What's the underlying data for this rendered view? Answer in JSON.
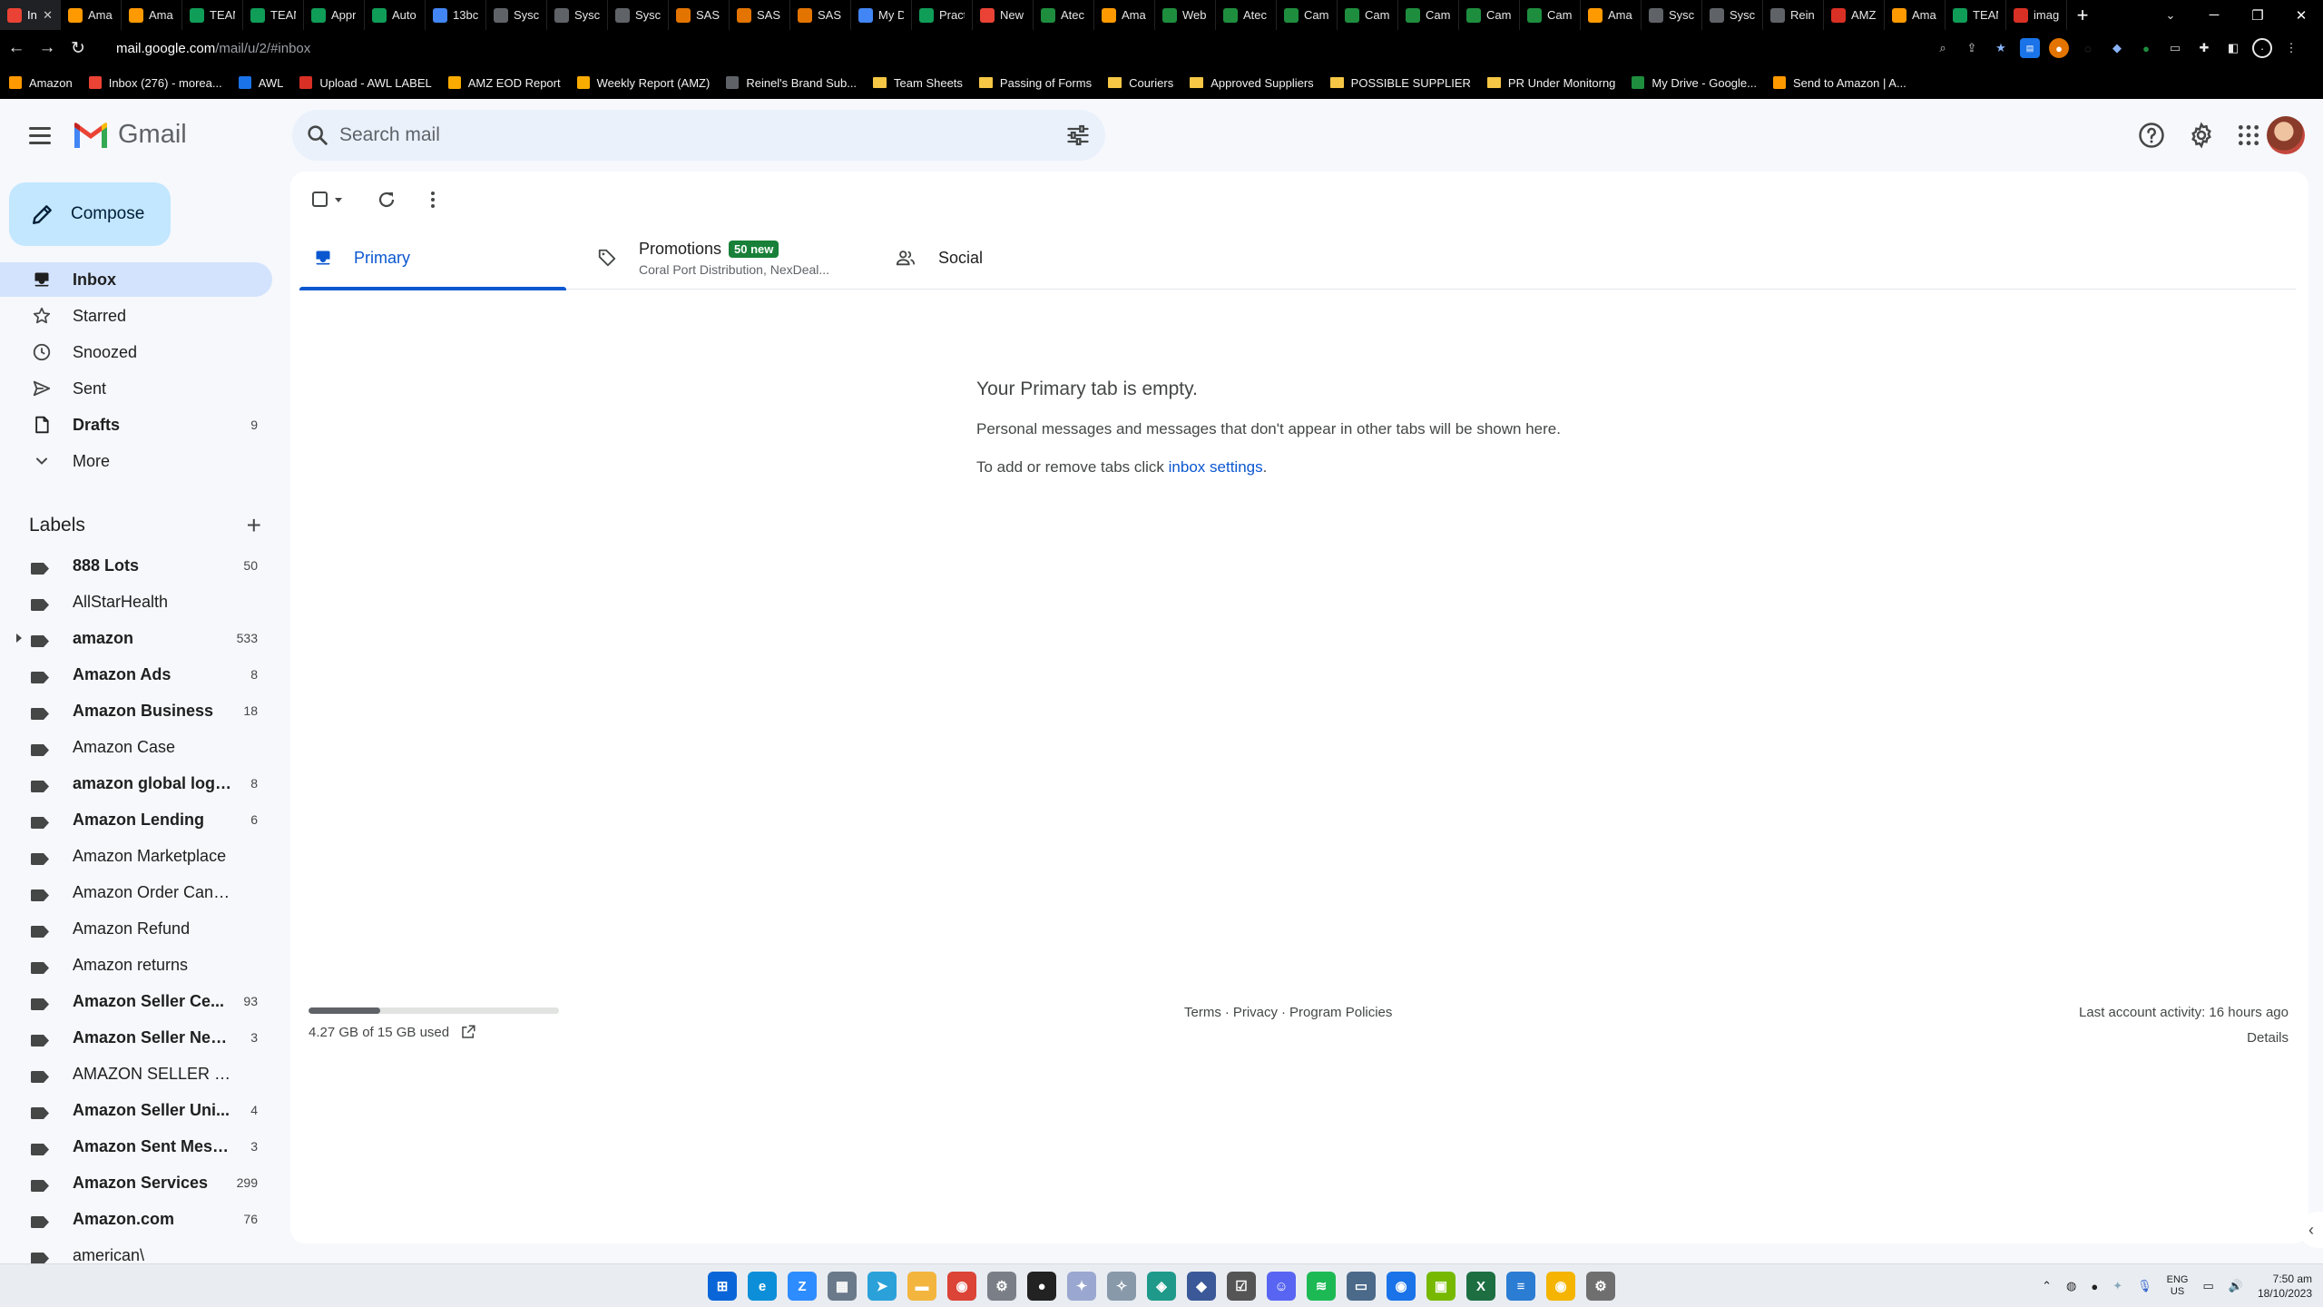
{
  "browser": {
    "tabs": [
      {
        "title": "Inbox",
        "icon": "gmail-icon",
        "color": "#ea4335",
        "active": true
      },
      {
        "title": "Ama",
        "icon": "amazon-icon",
        "color": "#ff9900"
      },
      {
        "title": "Ama",
        "icon": "amazon-icon",
        "color": "#ff9900"
      },
      {
        "title": "TEAM",
        "icon": "sheets-icon",
        "color": "#0f9d58"
      },
      {
        "title": "TEAM",
        "icon": "sheets-icon",
        "color": "#0f9d58"
      },
      {
        "title": "Appr",
        "icon": "sheets-icon",
        "color": "#0f9d58"
      },
      {
        "title": "Auto",
        "icon": "sheets-icon",
        "color": "#0f9d58"
      },
      {
        "title": "13bc",
        "icon": "drive-icon",
        "color": "#4285f4"
      },
      {
        "title": "Sysc",
        "icon": "page-icon",
        "color": "#5f6368"
      },
      {
        "title": "Sysc",
        "icon": "page-icon",
        "color": "#5f6368"
      },
      {
        "title": "Sysc",
        "icon": "page-icon",
        "color": "#5f6368"
      },
      {
        "title": "SAS",
        "icon": "sas-icon",
        "color": "#e37400"
      },
      {
        "title": "SAS",
        "icon": "sas-icon",
        "color": "#e37400"
      },
      {
        "title": "SAS",
        "icon": "sas-icon",
        "color": "#e37400"
      },
      {
        "title": "My D",
        "icon": "drive-icon",
        "color": "#4285f4"
      },
      {
        "title": "Pract",
        "icon": "sheets-icon",
        "color": "#0f9d58"
      },
      {
        "title": "New",
        "icon": "grid-icon",
        "color": "#ea4335"
      },
      {
        "title": "Atec",
        "icon": "w-icon",
        "color": "#1e8e3e"
      },
      {
        "title": "Ama",
        "icon": "amazon-icon",
        "color": "#ff9900"
      },
      {
        "title": "Web",
        "icon": "w-icon",
        "color": "#1e8e3e"
      },
      {
        "title": "Atec",
        "icon": "w-icon",
        "color": "#1e8e3e"
      },
      {
        "title": "Cam",
        "icon": "w-icon",
        "color": "#1e8e3e"
      },
      {
        "title": "Cam",
        "icon": "w-icon",
        "color": "#1e8e3e"
      },
      {
        "title": "Cam",
        "icon": "w-icon",
        "color": "#1e8e3e"
      },
      {
        "title": "Cam",
        "icon": "w-icon",
        "color": "#1e8e3e"
      },
      {
        "title": "Cam",
        "icon": "w-icon",
        "color": "#1e8e3e"
      },
      {
        "title": "Ama",
        "icon": "amazon-icon",
        "color": "#ff9900"
      },
      {
        "title": "Sysc",
        "icon": "page-icon",
        "color": "#5f6368"
      },
      {
        "title": "Sysc",
        "icon": "page-icon",
        "color": "#5f6368"
      },
      {
        "title": "Rein",
        "icon": "page-icon",
        "color": "#5f6368"
      },
      {
        "title": "AMZ",
        "icon": "amz-icon",
        "color": "#d93025"
      },
      {
        "title": "Ama",
        "icon": "amazon-icon",
        "color": "#ff9900"
      },
      {
        "title": "TEAM",
        "icon": "sheets-icon",
        "color": "#0f9d58"
      },
      {
        "title": "imag",
        "icon": "page-icon",
        "color": "#d93025"
      }
    ],
    "url_host": "mail.google.com",
    "url_path": "/mail/u/2/#inbox",
    "bookmarks": [
      {
        "label": "Amazon",
        "icon": "amazon-icon",
        "color": "#ff9900"
      },
      {
        "label": "Inbox (276) - morea...",
        "icon": "gmail-icon",
        "color": "#ea4335"
      },
      {
        "label": "AWL",
        "icon": "awl-icon",
        "color": "#1a73e8"
      },
      {
        "label": "Upload - AWL LABEL",
        "icon": "upload-icon",
        "color": "#d93025"
      },
      {
        "label": "AMZ EOD Report",
        "icon": "amz-icon",
        "color": "#f9ab00"
      },
      {
        "label": "Weekly Report (AMZ)",
        "icon": "amz-icon",
        "color": "#f9ab00"
      },
      {
        "label": "Reinel's Brand Sub...",
        "icon": "page-icon",
        "color": "#5f6368"
      },
      {
        "label": "Team Sheets",
        "icon": "folder-icon",
        "color": "#f6c744"
      },
      {
        "label": "Passing of Forms",
        "icon": "folder-icon",
        "color": "#f6c744"
      },
      {
        "label": "Couriers",
        "icon": "folder-icon",
        "color": "#f6c744"
      },
      {
        "label": "Approved Suppliers",
        "icon": "folder-icon",
        "color": "#f6c744"
      },
      {
        "label": "POSSIBLE SUPPLIER",
        "icon": "folder-icon",
        "color": "#f6c744"
      },
      {
        "label": "PR Under Monitorng",
        "icon": "folder-icon",
        "color": "#f6c744"
      },
      {
        "label": "My Drive - Google...",
        "icon": "drive-icon",
        "color": "#1e8e3e"
      },
      {
        "label": "Send to Amazon | A...",
        "icon": "amazon-icon",
        "color": "#ff9900"
      }
    ]
  },
  "gmail": {
    "app_name": "Gmail",
    "search_placeholder": "Search mail",
    "compose_label": "Compose",
    "nav": [
      {
        "label": "Inbox",
        "icon": "inbox-icon",
        "count": "",
        "active": true,
        "bold": true
      },
      {
        "label": "Starred",
        "icon": "star-icon",
        "count": ""
      },
      {
        "label": "Snoozed",
        "icon": "clock-icon",
        "count": ""
      },
      {
        "label": "Sent",
        "icon": "send-icon",
        "count": ""
      },
      {
        "label": "Drafts",
        "icon": "draft-icon",
        "count": "9",
        "bold": true
      },
      {
        "label": "More",
        "icon": "chevron-down-icon",
        "count": ""
      }
    ],
    "labels_title": "Labels",
    "labels": [
      {
        "name": "888 Lots",
        "count": "50",
        "bold": true
      },
      {
        "name": "AllStarHealth",
        "count": "",
        "bold": false
      },
      {
        "name": "amazon",
        "count": "533",
        "bold": true,
        "expandable": true
      },
      {
        "name": "Amazon Ads",
        "count": "8",
        "bold": true
      },
      {
        "name": "Amazon Business",
        "count": "18",
        "bold": true
      },
      {
        "name": "Amazon Case",
        "count": "",
        "bold": false
      },
      {
        "name": "amazon global logi...",
        "count": "8",
        "bold": true
      },
      {
        "name": "Amazon Lending",
        "count": "6",
        "bold": true
      },
      {
        "name": "Amazon Marketplace",
        "count": "",
        "bold": false
      },
      {
        "name": "Amazon Order Cancella...",
        "count": "",
        "bold": false
      },
      {
        "name": "Amazon Refund",
        "count": "",
        "bold": false
      },
      {
        "name": "Amazon returns",
        "count": "",
        "bold": false
      },
      {
        "name": "Amazon Seller Ce...",
        "count": "93",
        "bold": true
      },
      {
        "name": "Amazon Seller New...",
        "count": "3",
        "bold": true
      },
      {
        "name": "AMAZON SELLER SUPP...",
        "count": "",
        "bold": false
      },
      {
        "name": "Amazon Seller Uni...",
        "count": "4",
        "bold": true
      },
      {
        "name": "Amazon Sent Mess...",
        "count": "3",
        "bold": true
      },
      {
        "name": "Amazon Services",
        "count": "299",
        "bold": true
      },
      {
        "name": "Amazon.com",
        "count": "76",
        "bold": true
      },
      {
        "name": "american\\",
        "count": "",
        "bold": false
      }
    ],
    "tabs": {
      "primary": "Primary",
      "promotions": "Promotions",
      "promotions_badge": "50 new",
      "promotions_sub": "Coral Port Distribution, NexDeal...",
      "social": "Social"
    },
    "empty": {
      "title": "Your Primary tab is empty.",
      "description": "Personal messages and messages that don't appear in other tabs will be shown here.",
      "settings_prefix": "To add or remove tabs click ",
      "settings_link": "inbox settings",
      "settings_suffix": "."
    },
    "storage": {
      "text": "4.27 GB of 15 GB used",
      "fraction": 0.285
    },
    "footer": {
      "terms": "Terms",
      "sep": "·",
      "privacy": "Privacy",
      "policies": "Program Policies"
    },
    "activity": {
      "last": "Last account activity: 16 hours ago",
      "details": "Details"
    }
  },
  "taskbar": {
    "apps": [
      {
        "name": "start-icon",
        "color": "#0a66d8",
        "glyph": "⊞"
      },
      {
        "name": "edge-icon",
        "color": "#0c8fd8",
        "glyph": "e"
      },
      {
        "name": "zoom-icon",
        "color": "#2d8cff",
        "glyph": "Z"
      },
      {
        "name": "calculator-icon",
        "color": "#6b7a8a",
        "glyph": "▦"
      },
      {
        "name": "telegram-icon",
        "color": "#2aa1d9",
        "glyph": "➤"
      },
      {
        "name": "explorer-icon",
        "color": "#f3b53e",
        "glyph": "▬"
      },
      {
        "name": "chrome-icon",
        "color": "#db4437",
        "glyph": "◉"
      },
      {
        "name": "settings-icon",
        "color": "#7a7f87",
        "glyph": "⚙"
      },
      {
        "name": "github-icon",
        "color": "#222",
        "glyph": "●"
      },
      {
        "name": "app-icon",
        "color": "#9aa7d0",
        "glyph": "✦"
      },
      {
        "name": "app2-icon",
        "color": "#8899aa",
        "glyph": "✧"
      },
      {
        "name": "app3-icon",
        "color": "#1f9a8a",
        "glyph": "◈"
      },
      {
        "name": "vpn-icon",
        "color": "#3b5998",
        "glyph": "◆"
      },
      {
        "name": "todo-icon",
        "color": "#555",
        "glyph": "☑"
      },
      {
        "name": "discord-icon",
        "color": "#5865f2",
        "glyph": "☺"
      },
      {
        "name": "spotify-icon",
        "color": "#1db954",
        "glyph": "≋"
      },
      {
        "name": "rdp-icon",
        "color": "#4b6a8a",
        "glyph": "▭"
      },
      {
        "name": "chrome2-icon",
        "color": "#1a73e8",
        "glyph": "◉"
      },
      {
        "name": "nvidia-icon",
        "color": "#76b900",
        "glyph": "▣"
      },
      {
        "name": "excel-icon",
        "color": "#1d6f42",
        "glyph": "X"
      },
      {
        "name": "notepad-icon",
        "color": "#2b7cd3",
        "glyph": "≡"
      },
      {
        "name": "chrome3-icon",
        "color": "#f4b400",
        "glyph": "◉"
      },
      {
        "name": "gear2-icon",
        "color": "#6f6f6f",
        "glyph": "⚙"
      }
    ],
    "lang_top": "ENG",
    "lang_bottom": "US",
    "time": "7:50 am",
    "date": "18/10/2023"
  }
}
